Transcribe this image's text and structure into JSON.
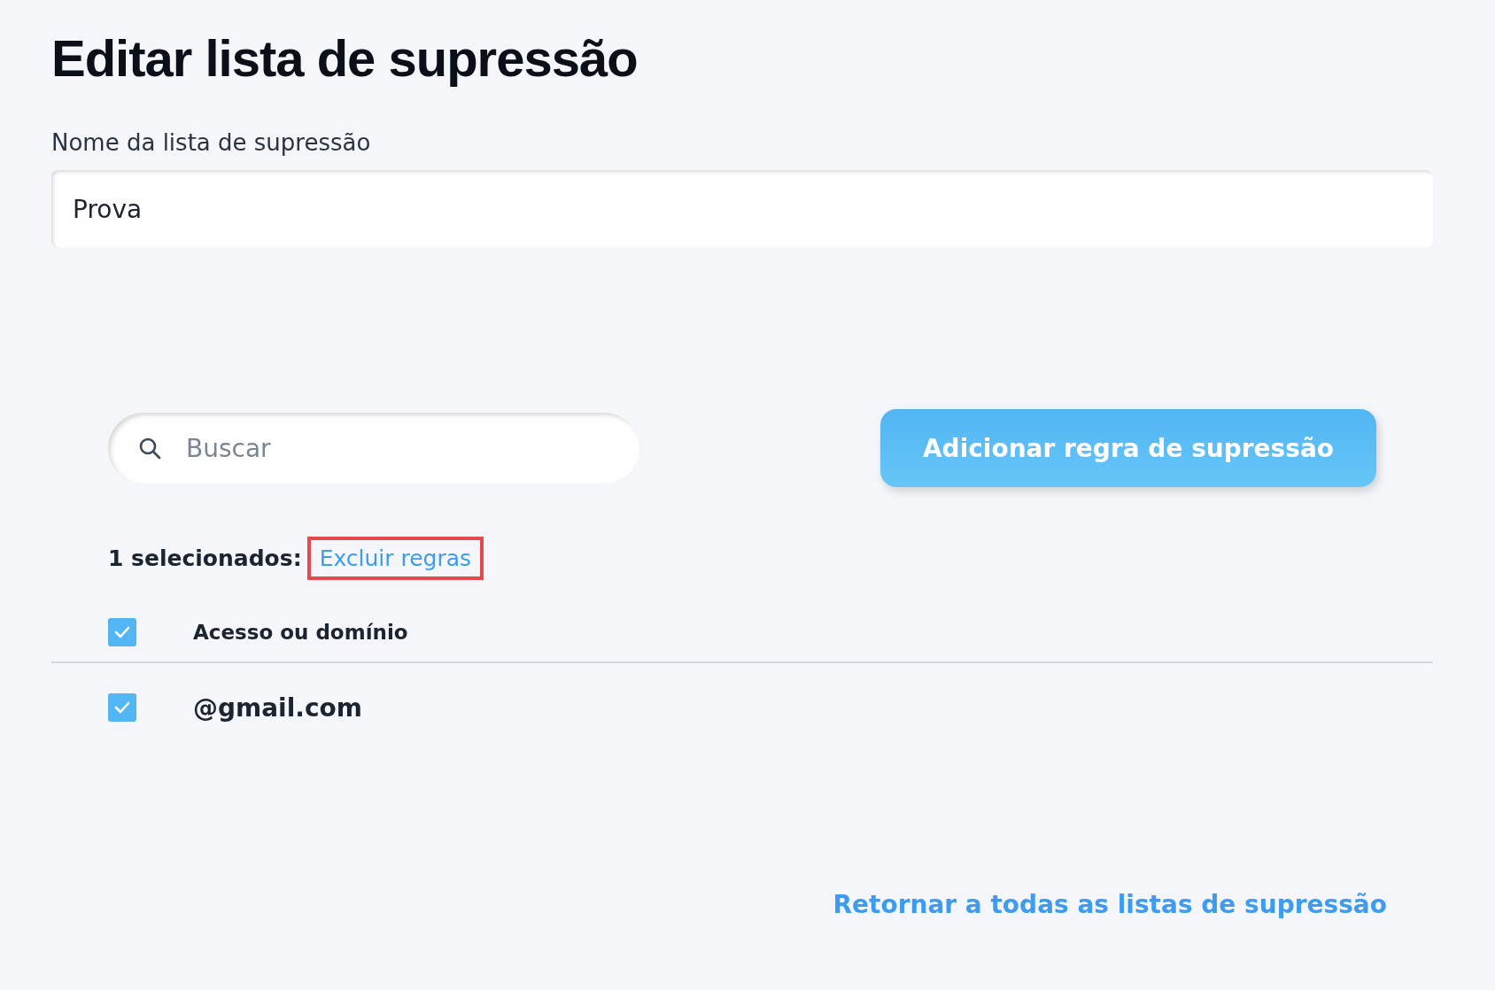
{
  "title": "Editar lista de supressão",
  "name_field": {
    "label": "Nome da lista de supressão",
    "value": "Prova"
  },
  "search": {
    "placeholder": "Buscar"
  },
  "add_button": "Adicionar regra de supressão",
  "selection": {
    "count_text": "1 selecionados:",
    "action": "Excluir regras",
    "highlighted": true
  },
  "table": {
    "header": {
      "checked": true,
      "label": "Acesso ou domínio"
    },
    "rows": [
      {
        "checked": true,
        "value": "@gmail.com"
      }
    ]
  },
  "return_link": "Retornar a todas as listas de supressão"
}
